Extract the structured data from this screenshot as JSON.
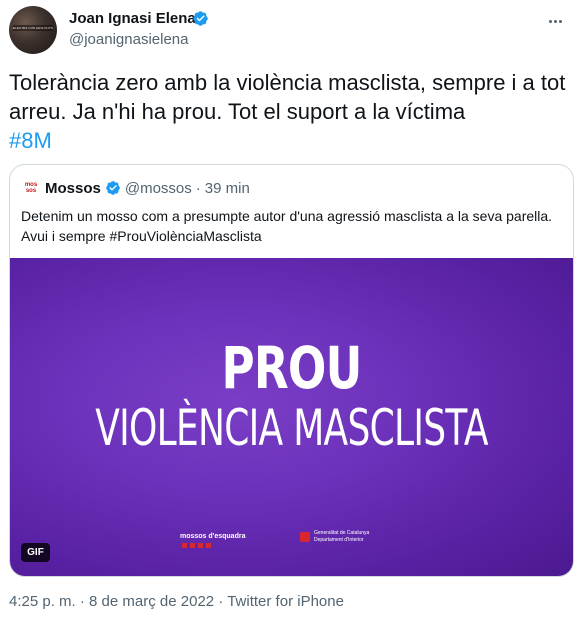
{
  "author": {
    "name": "Joan Ignasi Elena",
    "handle": "@joanignasielena",
    "avatar_text": "ELECTES CON ERIA PHYSICAL"
  },
  "tweet": {
    "text": "Tolerància zero amb la violència masclista, sempre i a tot arreu. Ja n'hi ha prou. Tot el suport a la víctima",
    "hashtag": "#8M"
  },
  "quoted": {
    "avatar_line1": "mos",
    "avatar_line2": "sos",
    "name": "Mossos",
    "handle": "@mossos",
    "separator": "·",
    "time": "39 min",
    "text": "Detenim un mosso com a presumpte autor d'una agressió masclista a la seva parella. Avui i sempre #ProuViolènciaMasclista",
    "media": {
      "title": "PROU",
      "subtitle": "VIOLÈNCIA MASCLISTA",
      "logo_left": "mossos d'esquadra",
      "logo_right_line1": "Generalitat de Catalunya",
      "logo_right_line2": "Departament d'Interior",
      "badge": "GIF"
    }
  },
  "footer": {
    "time": "4:25 p. m.",
    "separator": "·",
    "date": "8 de març de 2022",
    "source": "Twitter for iPhone"
  },
  "colors": {
    "accent": "#1d9bf0",
    "text": "#0f1419",
    "muted": "#536471",
    "media_purple": "#6d32bb"
  },
  "icons": [
    "verified-icon",
    "more-icon"
  ]
}
